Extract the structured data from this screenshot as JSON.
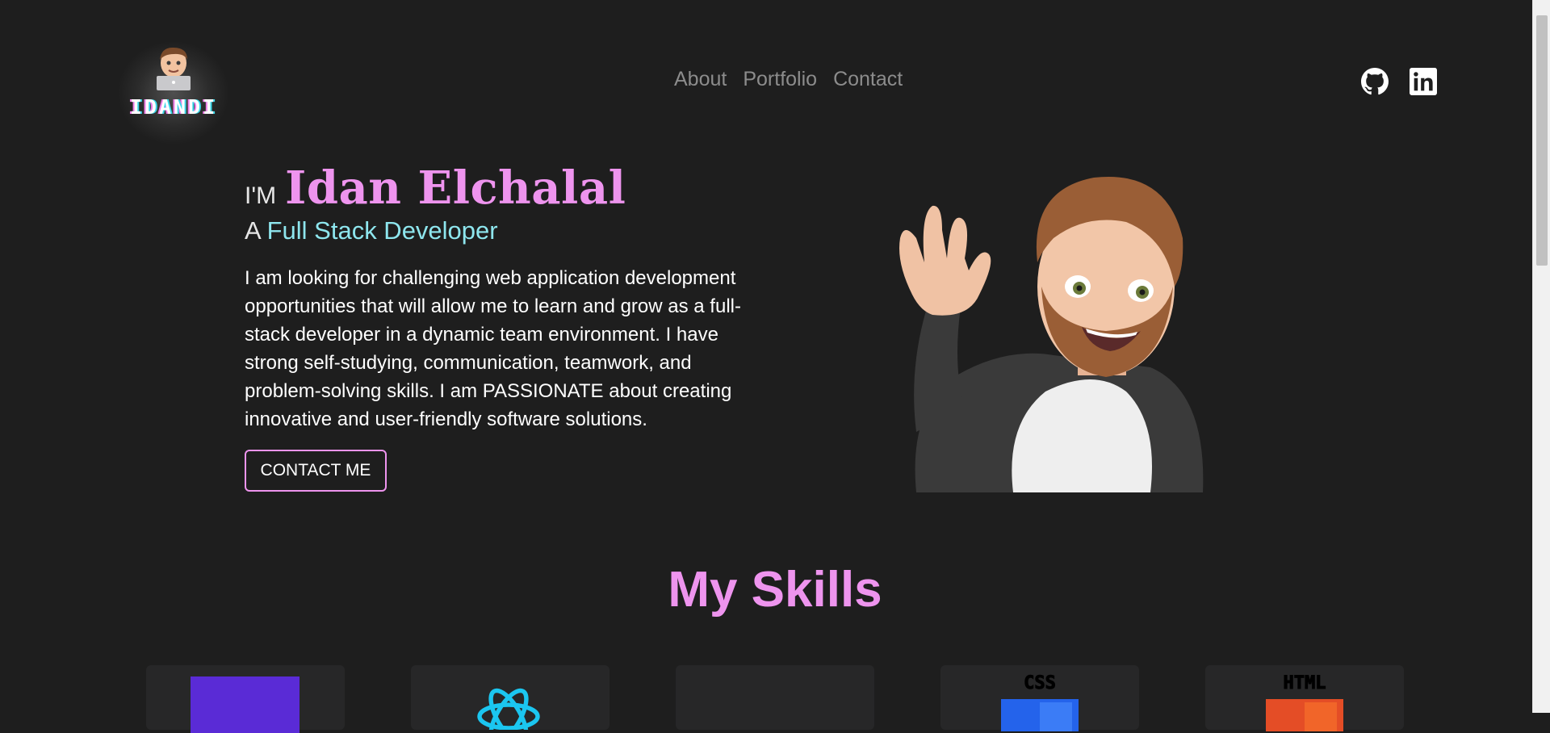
{
  "logo": {
    "text": "IDANDI"
  },
  "nav": {
    "items": [
      "About",
      "Portfolio",
      "Contact"
    ]
  },
  "social": [
    {
      "name": "github-icon"
    },
    {
      "name": "linkedin-icon"
    }
  ],
  "hero": {
    "prefix": "I'M",
    "name": "Idan Elchalal",
    "role_prefix": "A",
    "role": "Full Stack Developer",
    "bio": "I am looking for challenging web application development opportunities that will allow me to learn and grow as a full-stack developer in a dynamic team environment. I have strong self-studying, communication, teamwork, and problem-solving skills. I am PASSIONATE about creating innovative and user-friendly software solutions.",
    "cta": "CONTACT ME"
  },
  "skills": {
    "title": "My Skills",
    "cards": [
      {
        "icon": "purple-square-icon",
        "label": ""
      },
      {
        "icon": "react-icon",
        "label": ""
      },
      {
        "icon": "blank-icon",
        "label": ""
      },
      {
        "icon": "css-icon",
        "label": "CSS"
      },
      {
        "icon": "html-icon",
        "label": "HTML"
      }
    ]
  },
  "colors": {
    "background": "#1e1e1e",
    "accent_pink": "#ee94ee",
    "accent_cyan": "#8ee6ee",
    "nav_gray": "#8c8c8c"
  }
}
